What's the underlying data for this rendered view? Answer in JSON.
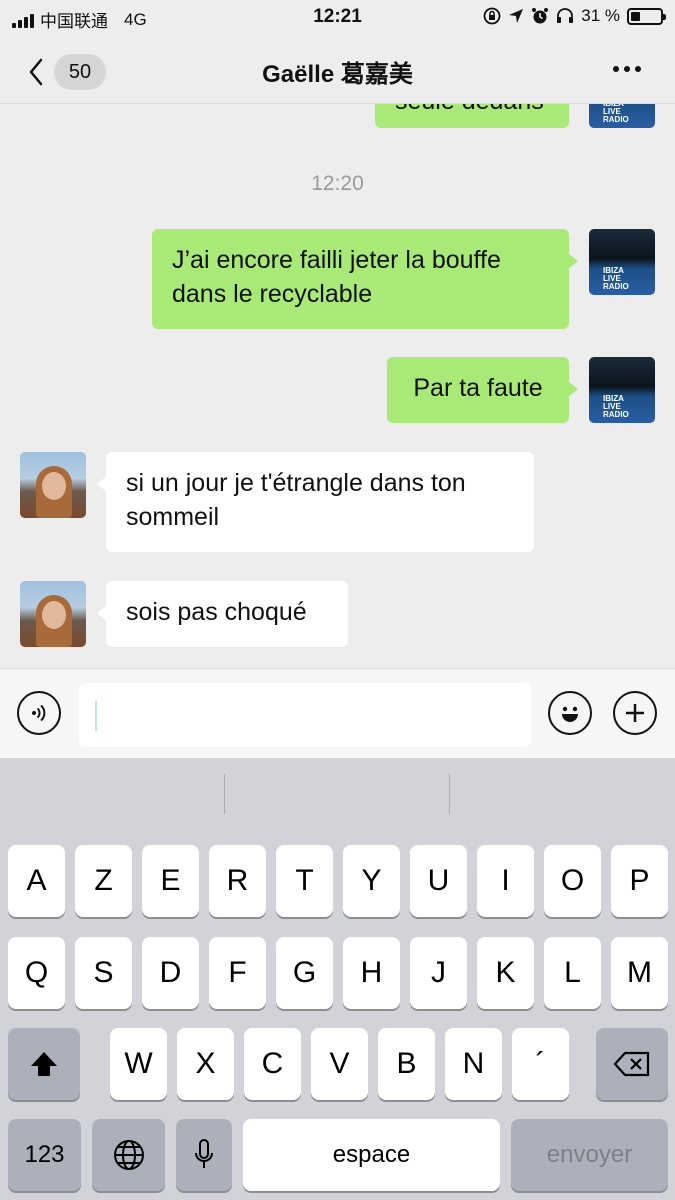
{
  "status_bar": {
    "carrier": "中国联通",
    "network": "4G",
    "time": "12:21",
    "battery": "31 %",
    "battery_level": 0.31
  },
  "header": {
    "unread_count": "50",
    "title": "Gaëlle 葛嘉美"
  },
  "chat": {
    "partial_message": "seule dedans",
    "timestamp": "12:20",
    "messages": [
      {
        "from": "me",
        "text": "J’ai encore failli jeter la bouffe dans le recyclable"
      },
      {
        "from": "me",
        "text": "Par ta faute"
      },
      {
        "from": "them",
        "text": "si un jour je t'étrangle dans ton sommeil"
      },
      {
        "from": "them",
        "text": "sois pas choqué"
      }
    ],
    "my_avatar_text": "IBIZA LIVE RADIO"
  },
  "input": {
    "value": ""
  },
  "keyboard": {
    "row1": [
      "A",
      "Z",
      "E",
      "R",
      "T",
      "Y",
      "U",
      "I",
      "O",
      "P"
    ],
    "row2": [
      "Q",
      "S",
      "D",
      "F",
      "G",
      "H",
      "J",
      "K",
      "L",
      "M"
    ],
    "row3": [
      "W",
      "X",
      "C",
      "V",
      "B",
      "N",
      "´"
    ],
    "numbers_key": "123",
    "space_key": "espace",
    "send_key": "envoyer"
  },
  "colors": {
    "my_bubble": "#a9e977",
    "their_bubble": "#ffffff",
    "background": "#ededed",
    "keyboard": "#d1d3d9"
  },
  "icons": [
    "back-chevron-icon",
    "more-icon",
    "voice-icon",
    "emoji-icon",
    "plus-icon",
    "shift-icon",
    "backspace-icon",
    "globe-icon",
    "microphone-icon"
  ]
}
